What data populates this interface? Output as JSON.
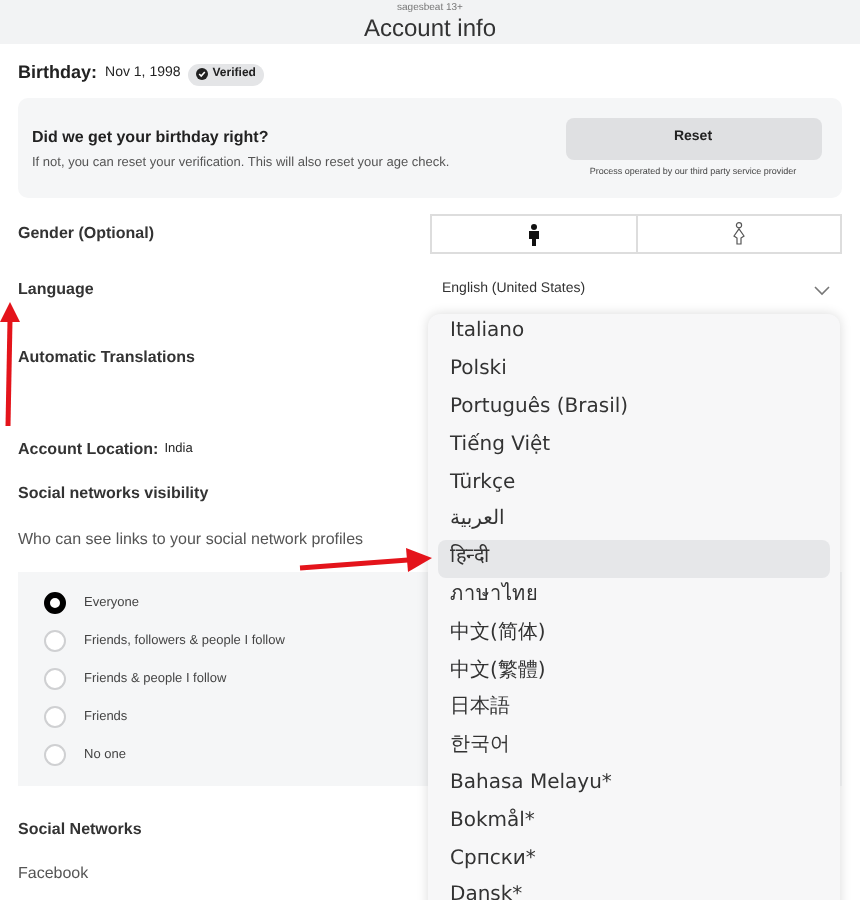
{
  "header": {
    "subtitle": "sagesbeat 13+",
    "title": "Account info"
  },
  "birthday": {
    "label": "Birthday:",
    "value": "Nov 1, 1998",
    "badge": "Verified"
  },
  "birthday_card": {
    "title": "Did we get your birthday right?",
    "text": "If not, you can reset your verification. This will also reset your age check.",
    "button": "Reset",
    "note": "Process operated by our third party service provider"
  },
  "gender": {
    "label": "Gender (Optional)"
  },
  "language": {
    "label": "Language",
    "value": "English (United States)",
    "options": [
      {
        "label": "Italiano",
        "selected": false
      },
      {
        "label": "Polski",
        "selected": false
      },
      {
        "label": "Português (Brasil)",
        "selected": false
      },
      {
        "label": "Tiếng Việt",
        "selected": false
      },
      {
        "label": "Türkçe",
        "selected": false
      },
      {
        "label": "العربية",
        "selected": false
      },
      {
        "label": "हिन्दी",
        "selected": true
      },
      {
        "label": "ภาษาไทย",
        "selected": false
      },
      {
        "label": "中文(简体)",
        "selected": false
      },
      {
        "label": "中文(繁體)",
        "selected": false
      },
      {
        "label": "日本語",
        "selected": false
      },
      {
        "label": "한국어",
        "selected": false
      },
      {
        "label": "Bahasa Melayu*",
        "selected": false
      },
      {
        "label": "Bokmål*",
        "selected": false
      },
      {
        "label": "Српски*",
        "selected": false
      },
      {
        "label": "Dansk*",
        "selected": false
      }
    ]
  },
  "automatic_translations": {
    "label": "Automatic Translations"
  },
  "account_location": {
    "label": "Account Location:",
    "value": "India"
  },
  "social_visibility": {
    "title": "Social networks visibility",
    "question": "Who can see links to your social network profiles",
    "options": [
      {
        "label": "Everyone",
        "selected": true
      },
      {
        "label": "Friends, followers & people I follow",
        "selected": false
      },
      {
        "label": "Friends & people I follow",
        "selected": false
      },
      {
        "label": "Friends",
        "selected": false
      },
      {
        "label": "No one",
        "selected": false
      }
    ]
  },
  "social_networks": {
    "title": "Social Networks",
    "items": [
      "Facebook"
    ]
  }
}
